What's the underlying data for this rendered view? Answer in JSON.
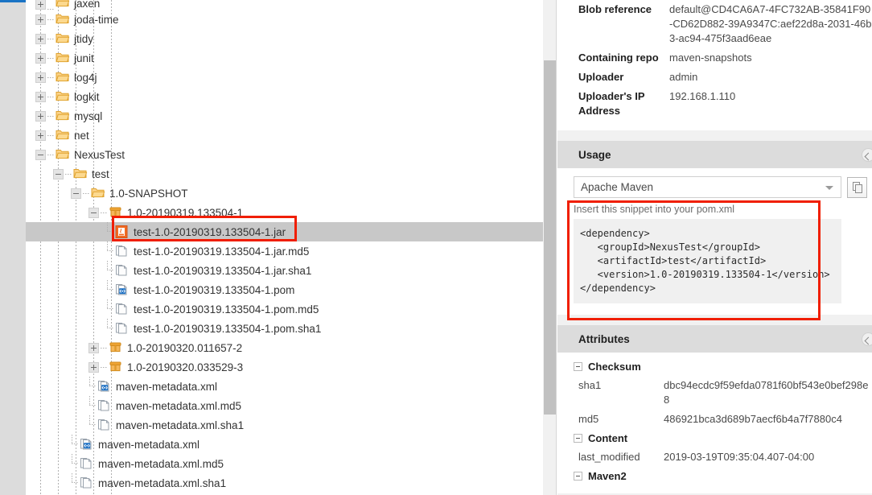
{
  "tree": {
    "nodes": [
      {
        "label": "jaxen",
        "depth": 1,
        "type": "folder",
        "expander": "plus",
        "icon": "folder-icon",
        "clipped": true
      },
      {
        "label": "joda-time",
        "depth": 1,
        "type": "folder",
        "expander": "plus",
        "icon": "folder-icon"
      },
      {
        "label": "jtidy",
        "depth": 1,
        "type": "folder",
        "expander": "plus",
        "icon": "folder-icon"
      },
      {
        "label": "junit",
        "depth": 1,
        "type": "folder",
        "expander": "plus",
        "icon": "folder-icon"
      },
      {
        "label": "log4j",
        "depth": 1,
        "type": "folder",
        "expander": "plus",
        "icon": "folder-icon"
      },
      {
        "label": "logkit",
        "depth": 1,
        "type": "folder",
        "expander": "plus",
        "icon": "folder-icon"
      },
      {
        "label": "mysql",
        "depth": 1,
        "type": "folder",
        "expander": "plus",
        "icon": "folder-icon"
      },
      {
        "label": "net",
        "depth": 1,
        "type": "folder",
        "expander": "plus",
        "icon": "folder-icon"
      },
      {
        "label": "NexusTest",
        "depth": 1,
        "type": "folder",
        "expander": "minus",
        "icon": "folder-icon"
      },
      {
        "label": "test",
        "depth": 2,
        "type": "folder",
        "expander": "minus",
        "icon": "folder-icon"
      },
      {
        "label": "1.0-SNAPSHOT",
        "depth": 3,
        "type": "folder",
        "expander": "minus",
        "icon": "folder-icon"
      },
      {
        "label": "1.0-20190319.133504-1",
        "depth": 4,
        "type": "package",
        "expander": "minus",
        "icon": "package-icon"
      },
      {
        "label": "test-1.0-20190319.133504-1.jar",
        "depth": 5,
        "type": "jar",
        "expander": "leaf",
        "icon": "jar-icon",
        "selected": true
      },
      {
        "label": "test-1.0-20190319.133504-1.jar.md5",
        "depth": 5,
        "type": "file",
        "expander": "leaf",
        "icon": "file-icon"
      },
      {
        "label": "test-1.0-20190319.133504-1.jar.sha1",
        "depth": 5,
        "type": "file",
        "expander": "leaf",
        "icon": "file-icon"
      },
      {
        "label": "test-1.0-20190319.133504-1.pom",
        "depth": 5,
        "type": "xml",
        "expander": "leaf",
        "icon": "xml-icon"
      },
      {
        "label": "test-1.0-20190319.133504-1.pom.md5",
        "depth": 5,
        "type": "file",
        "expander": "leaf",
        "icon": "file-icon"
      },
      {
        "label": "test-1.0-20190319.133504-1.pom.sha1",
        "depth": 5,
        "type": "file",
        "expander": "leaf-last",
        "icon": "file-icon"
      },
      {
        "label": "1.0-20190320.011657-2",
        "depth": 4,
        "type": "package",
        "expander": "plus",
        "icon": "package-icon"
      },
      {
        "label": "1.0-20190320.033529-3",
        "depth": 4,
        "type": "package",
        "expander": "plus",
        "icon": "package-icon"
      },
      {
        "label": "maven-metadata.xml",
        "depth": 4,
        "type": "xml",
        "expander": "leaf",
        "icon": "xml-icon"
      },
      {
        "label": "maven-metadata.xml.md5",
        "depth": 4,
        "type": "file",
        "expander": "leaf",
        "icon": "file-icon"
      },
      {
        "label": "maven-metadata.xml.sha1",
        "depth": 4,
        "type": "file",
        "expander": "leaf-last",
        "icon": "file-icon"
      },
      {
        "label": "maven-metadata.xml",
        "depth": 3,
        "type": "xml",
        "expander": "leaf",
        "icon": "xml-icon"
      },
      {
        "label": "maven-metadata.xml.md5",
        "depth": 3,
        "type": "file",
        "expander": "leaf",
        "icon": "file-icon"
      },
      {
        "label": "maven-metadata.xml.sha1",
        "depth": 3,
        "type": "file",
        "expander": "leaf-last",
        "icon": "file-icon"
      }
    ]
  },
  "summary": {
    "rows": [
      {
        "label": "Blob reference",
        "value": "default@CD4CA6A7-4FC732AB-35841F90-CD62D882-39A9347C:aef22d8a-2031-46b3-ac94-475f3aad6eae"
      },
      {
        "label": "Containing repo",
        "value": "maven-snapshots"
      },
      {
        "label": "Uploader",
        "value": "admin"
      },
      {
        "label": "Uploader's IP Address",
        "value": "192.168.1.110"
      }
    ]
  },
  "usage": {
    "title": "Usage",
    "selected_tool": "Apache Maven",
    "options": [
      "Apache Maven"
    ],
    "copy_icon": "copy-icon",
    "hint": "Insert this snippet into your pom.xml",
    "snippet": "<dependency>\n   <groupId>NexusTest</groupId>\n   <artifactId>test</artifactId>\n   <version>1.0-20190319.133504-1</version>\n</dependency>"
  },
  "attributes": {
    "title": "Attributes",
    "groups": [
      {
        "name": "Checksum",
        "rows": [
          {
            "key": "sha1",
            "value": "dbc94ecdc9f59efda0781f60bf543e0bef298e8"
          },
          {
            "key": "md5",
            "value": "486921bca3d689b7aecf6b4a7f7880c4"
          }
        ]
      },
      {
        "name": "Content",
        "rows": [
          {
            "key": "last_modified",
            "value": "2019-03-19T09:35:04.407-04:00"
          }
        ]
      },
      {
        "name": "Maven2",
        "rows": []
      }
    ]
  },
  "colors": {
    "accent_blue": "#1a73c4",
    "annotation_red": "#f01e00",
    "folder_orange": "#f0a020",
    "selection_gray": "#c8c8c8",
    "header_gray": "#dcdcdc"
  }
}
